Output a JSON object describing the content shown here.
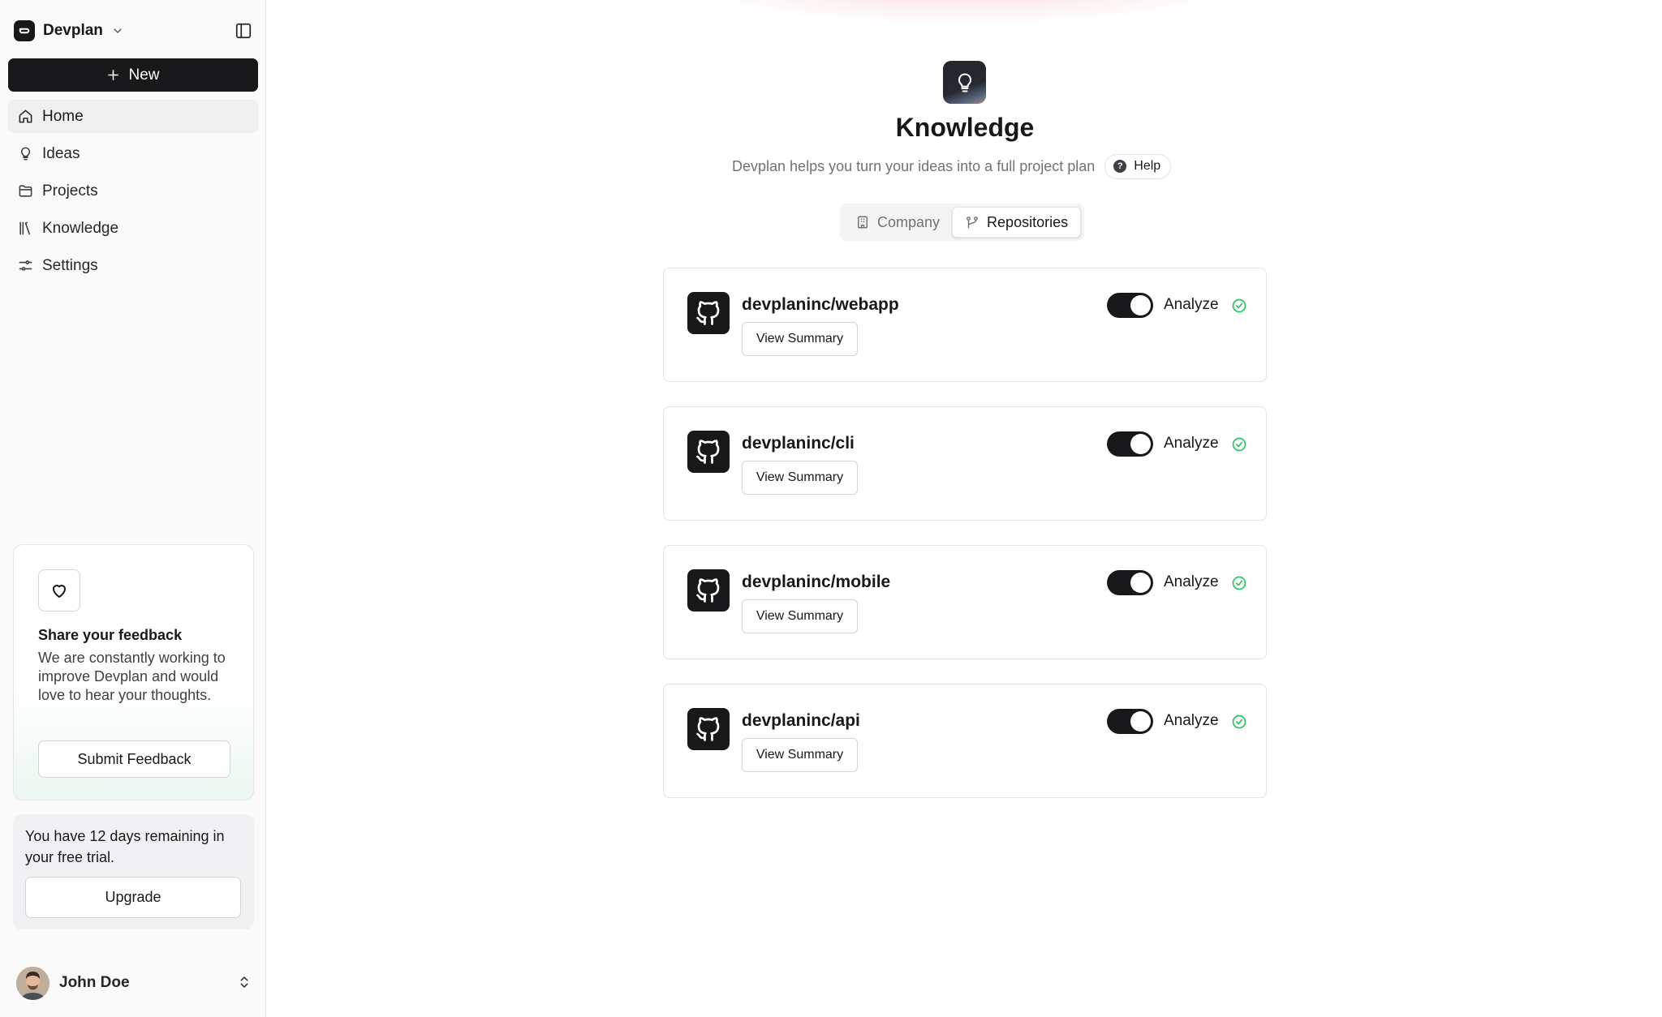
{
  "workspace": {
    "name": "Devplan"
  },
  "sidebar": {
    "new_label": "New",
    "items": [
      {
        "label": "Home",
        "icon": "home-icon",
        "active": true
      },
      {
        "label": "Ideas",
        "icon": "lightbulb-icon"
      },
      {
        "label": "Projects",
        "icon": "folder-icon"
      },
      {
        "label": "Knowledge",
        "icon": "library-icon"
      },
      {
        "label": "Settings",
        "icon": "settings-sliders-icon"
      }
    ],
    "feedback": {
      "title": "Share your feedback",
      "text": "We are constantly working to improve Devplan and would love to hear your thoughts.",
      "button": "Submit Feedback"
    },
    "trial": {
      "text": "You have 12 days remaining in your free trial.",
      "button": "Upgrade"
    },
    "user": {
      "name": "John Doe"
    }
  },
  "main": {
    "title": "Knowledge",
    "subtitle": "Devplan helps you turn your ideas into a full project plan",
    "help_label": "Help",
    "tabs": [
      {
        "label": "Company",
        "icon": "building-icon",
        "active": false
      },
      {
        "label": "Repositories",
        "icon": "git-branch-icon",
        "active": true
      }
    ],
    "repositories": [
      {
        "name": "devplaninc/webapp",
        "button": "View Summary",
        "toggle_label": "Analyze",
        "enabled": true,
        "status": "analyzed"
      },
      {
        "name": "devplaninc/cli",
        "button": "View Summary",
        "toggle_label": "Analyze",
        "enabled": true,
        "status": "analyzed"
      },
      {
        "name": "devplaninc/mobile",
        "button": "View Summary",
        "toggle_label": "Analyze",
        "enabled": true,
        "status": "analyzed"
      },
      {
        "name": "devplaninc/api",
        "button": "View Summary",
        "toggle_label": "Analyze",
        "enabled": true,
        "status": "analyzed"
      }
    ]
  },
  "colors": {
    "primary": "#18181b",
    "success": "#22c55e",
    "muted": "#71717a",
    "border": "#e4e4e7"
  }
}
